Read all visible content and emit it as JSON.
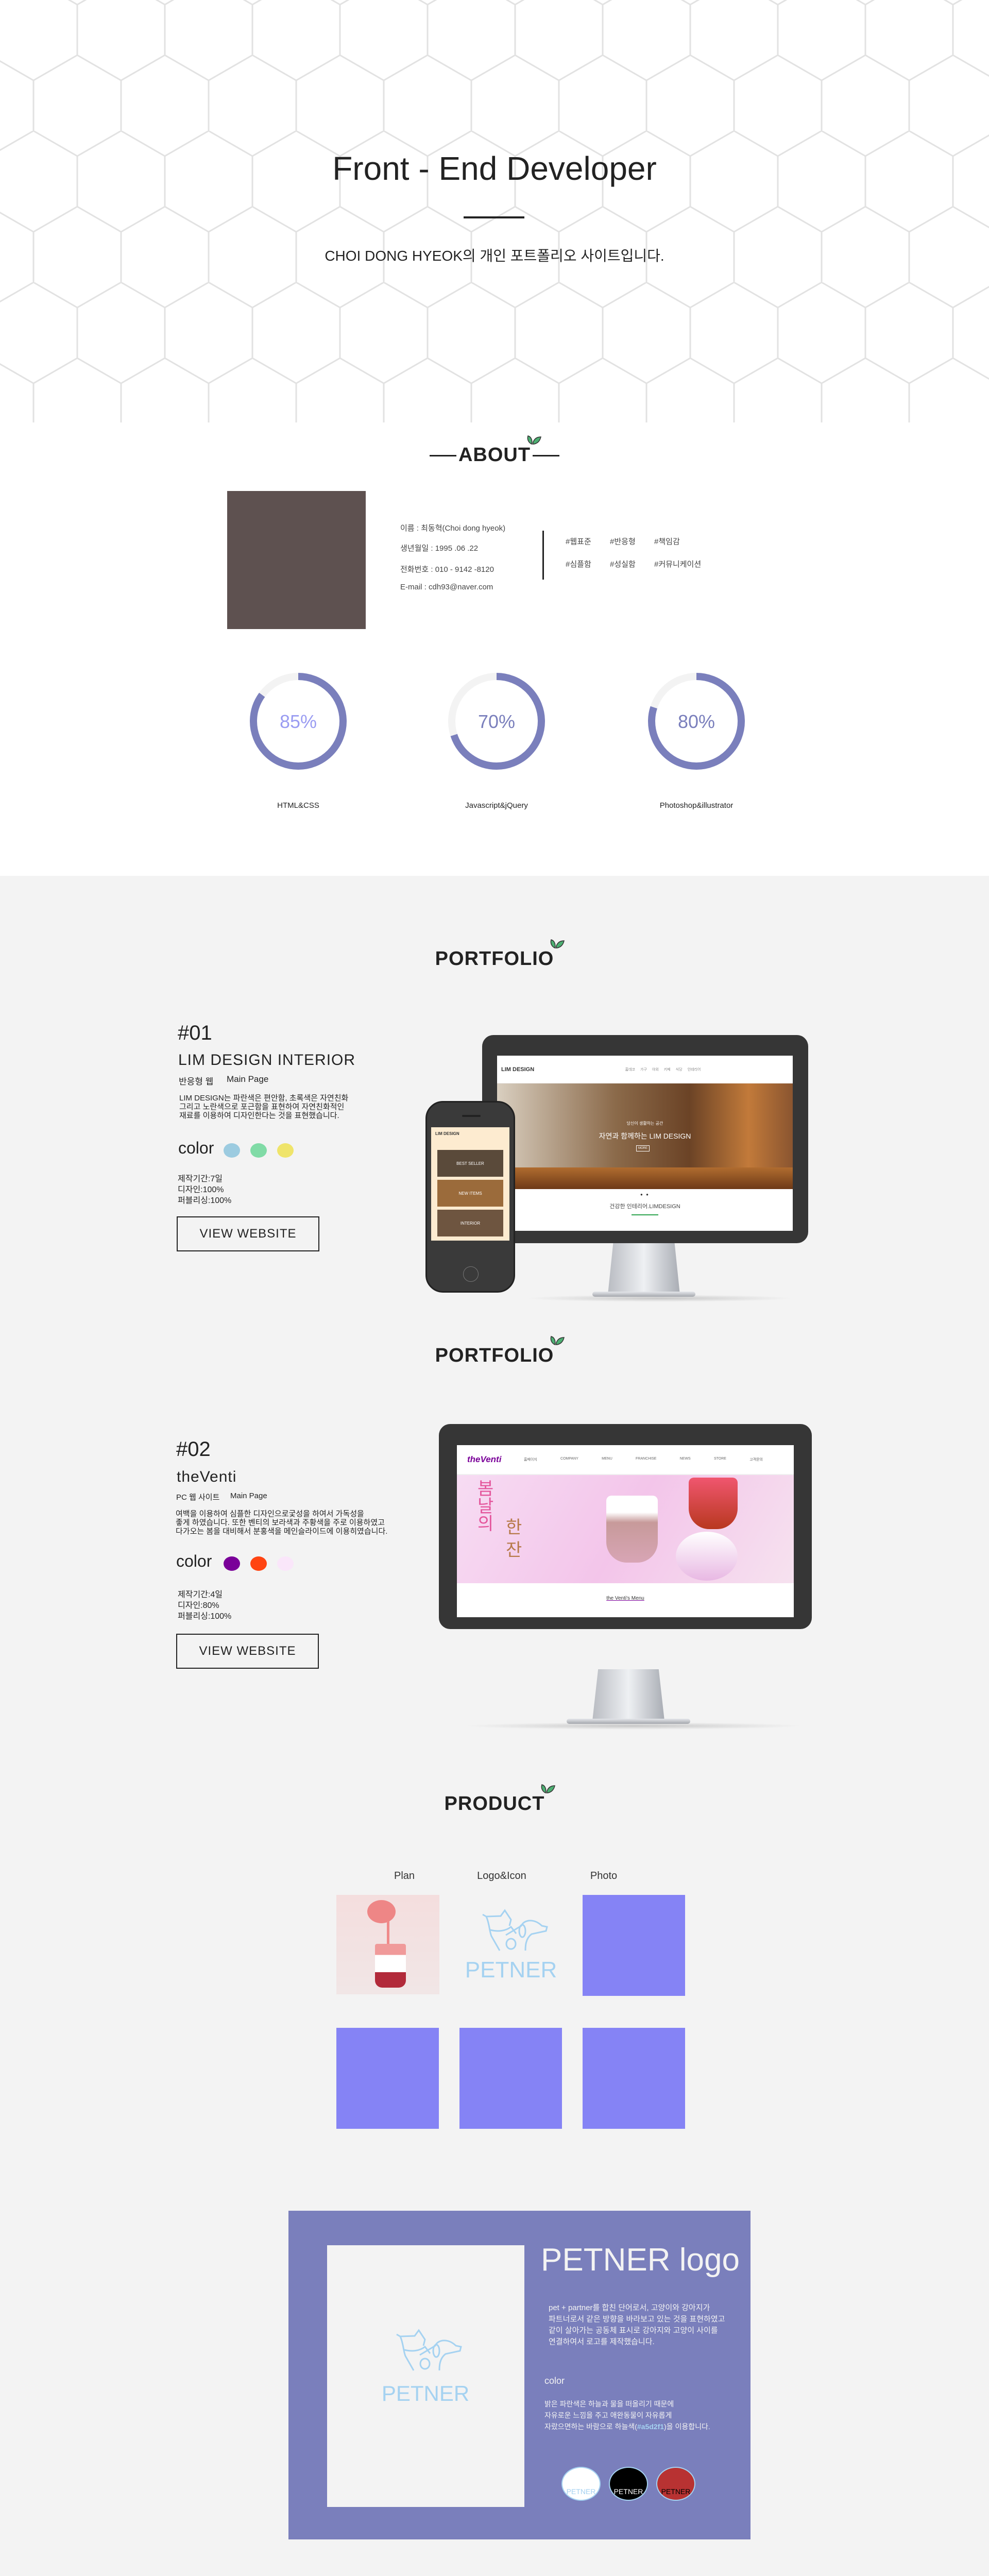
{
  "hero": {
    "title": "Front - End Developer",
    "subtitle": "CHOI DONG HYEOK의 개인 포트폴리오 사이트입니다."
  },
  "about": {
    "heading": "ABOUT",
    "info": [
      "이름 : 최동혁(Choi dong hyeok)",
      "생년월일 : 1995 .06 .22",
      "전화번호 : 010 - 9142 -8120",
      "E-mail : cdh93@naver.com"
    ],
    "tags": [
      "#웹표준",
      "#반응형",
      "#책임감",
      "#심플함",
      "#성실함",
      "#커뮤니케이션"
    ],
    "skills": [
      {
        "label": "HTML&CSS",
        "percent": 85,
        "text": "85%",
        "text_color": "#9a9cf2"
      },
      {
        "label": "Javascript&jQuery",
        "percent": 70,
        "text": "70%",
        "text_color": "#7a7fbc"
      },
      {
        "label": "Photoshop&illustrator",
        "percent": 80,
        "text": "80%",
        "text_color": "#7a7fbc"
      }
    ],
    "accent": "#7a7fbc"
  },
  "portfolio": [
    {
      "heading": "PORTFOLIO",
      "number": "#01",
      "title": "LIM DESIGN INTERIOR",
      "type": "반응형 웹",
      "page": "Main Page",
      "description": [
        "LIM DESIGN는 파란색은 편안함, 초록색은 자연친화",
        "그리고 노란색으로 포근함을 표현하여 자연친화적인",
        "재료를 이용하여 디자인한다는 것을 표현했습니다."
      ],
      "color_label": "color",
      "colors": [
        "#9ccbe0",
        "#80dba6",
        "#efe46a"
      ],
      "stats": [
        "제작기간:7일",
        "디자인:100%",
        "퍼블리싱:100%"
      ],
      "button": "VIEW WEBSITE",
      "mockup": {
        "logo": "LIM DESIGN",
        "nav": [
          "홈데코",
          "가구",
          "야외",
          "키페",
          "식당",
          "인테리어"
        ],
        "hero_small": "당신이 생활하는 공간",
        "hero_big": "자연과 함께하는 LIM DESIGN",
        "more": "MORE",
        "section": "건강한 인테리어.LIMDESIGN",
        "mobile_cards": [
          "BEST SELLER",
          "NEW ITEMS",
          "INTERIOR"
        ]
      }
    },
    {
      "heading": "PORTFOLIO",
      "number": "#02",
      "title": "theVenti",
      "type": "PC 웹 사이트",
      "page": "Main Page",
      "description": [
        "여백을 이용하여 심플한 디자인으로궃성을 하여서 가독성을",
        "좋게 하였습니다. 또한 벤티의 보라색과 주황색을 주로 이용하였고",
        "다가오는 봄을 대비해서 분홍색을 메인슬라이드에 이용히였습니다."
      ],
      "color_label": "color",
      "colors": [
        "#7a0099",
        "#ff4412",
        "#fae6fa"
      ],
      "stats": [
        "제작기간:4일",
        "디자인:80%",
        "퍼블리싱:100%"
      ],
      "button": "VIEW WEBSITE",
      "mockup": {
        "logo": "theVenti",
        "nav": [
          "홈페이지",
          "COMPANY",
          "MENU",
          "FRANCHISE",
          "NEWS",
          "STORE",
          "고객문의"
        ],
        "slide_text": [
          "봄",
          "날",
          "의",
          "한",
          "잔"
        ],
        "menu_title": "the Venti's Menu"
      }
    }
  ],
  "product": {
    "heading": "PRODUCT",
    "labels": [
      "Plan",
      "Logo&Icon",
      "Photo"
    ],
    "tile_color": "#8583f5",
    "logo_text": "PETNER"
  },
  "petner": {
    "title": "PETNER logo",
    "logo_text": "PETNER",
    "description": [
      "pet + partner를 합친 단어로서, 고양이와 강아지가",
      "파트너로서 같은 방향을 바라보고 있는 것을 표현하였고",
      "같이 살아가는 공동체 표시로  강아지와 고양이 사이를",
      "연결하여서 로고를 제작했습니다."
    ],
    "color_heading": "color",
    "color_text": [
      "밝은 파란색은 하늘과 물을 떠올리기 때문에",
      "자유로운 느낌을 주고 애완동물이 자유롭게"
    ],
    "color_text_last": {
      "before": "자랐으면하는 바람으로 하늘색(",
      "hex": "#a5d2f1",
      "after": ")을 이용합니다."
    },
    "badges": [
      {
        "text": "PETNER",
        "bg": "#ffffff",
        "fg": "#a5d2f1"
      },
      {
        "text": "PETNER",
        "bg": "#000000",
        "fg": "#ffffff"
      },
      {
        "text": "PETNER",
        "bg": "#b83232",
        "fg": "#000000"
      }
    ],
    "box_color": "#7a7fbc"
  }
}
